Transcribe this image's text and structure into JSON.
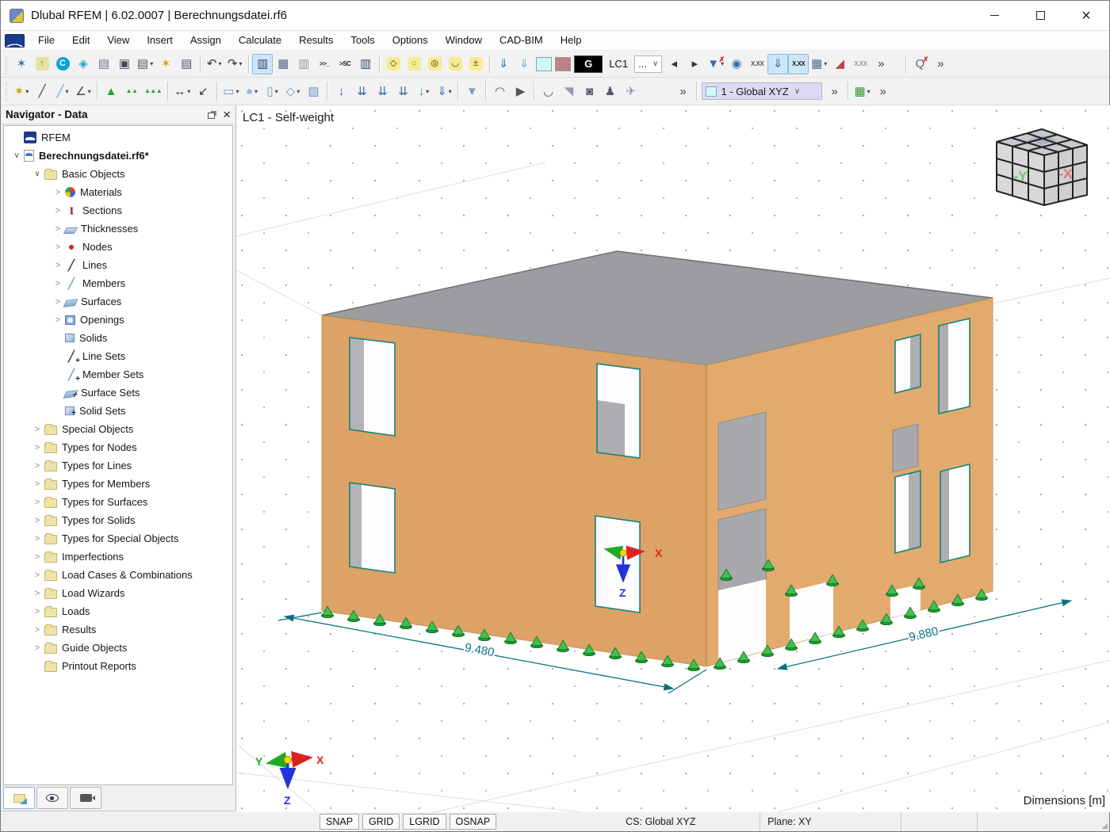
{
  "window": {
    "title": "Dlubal RFEM | 6.02.0007 | Berechnungsdatei.rf6"
  },
  "menu": {
    "items": [
      "File",
      "Edit",
      "View",
      "Insert",
      "Assign",
      "Calculate",
      "Results",
      "Tools",
      "Options",
      "Window",
      "CAD-BIM",
      "Help"
    ]
  },
  "toolbar1": [
    {
      "type": "handle"
    },
    {
      "name": "new-model-button",
      "glyph": "✶",
      "color": "#3a6ea5"
    },
    {
      "name": "open-model-button",
      "glyph": "↑",
      "color": "#2fa03c",
      "bg": "#eadfa4"
    },
    {
      "name": "dlubal-center-button",
      "glyph": "C",
      "color": "#ffffff",
      "bg": "#00a3d9",
      "round": true
    },
    {
      "name": "open-cloud-model-button",
      "glyph": "◈",
      "color": "#28a8c8"
    },
    {
      "name": "model-settings-button",
      "glyph": "▤",
      "color": "#667788"
    },
    {
      "name": "save-button",
      "glyph": "▣",
      "color": "#444a55"
    },
    {
      "name": "print-button",
      "glyph": "▤",
      "color": "#555566",
      "dd": true
    },
    {
      "name": "new-printout-report-button",
      "glyph": "✶",
      "color": "#d4a500"
    },
    {
      "name": "printout-report-button",
      "glyph": "▤",
      "color": "#555566"
    },
    {
      "type": "sep"
    },
    {
      "name": "undo-button",
      "glyph": "↶",
      "color": "#333333",
      "dd": true
    },
    {
      "name": "redo-button",
      "glyph": "↷",
      "color": "#333333",
      "dd": true
    },
    {
      "type": "sep"
    },
    {
      "name": "navigator-toggle-button",
      "glyph": "▥",
      "color": "#334466",
      "active": true
    },
    {
      "name": "tables-toggle-button",
      "glyph": "▦",
      "color": "#556688"
    },
    {
      "name": "panel-toggle-button",
      "glyph": "▥",
      "color": "#8899aa"
    },
    {
      "name": "console-toggle-button",
      "glyph": ">>_",
      "small": true,
      "color": "#222222"
    },
    {
      "name": "script-console-button",
      "glyph": ">SC",
      "small": true,
      "color": "#222222"
    },
    {
      "name": "display-properties-button",
      "glyph": "▥",
      "color": "#334466"
    },
    {
      "type": "sep"
    },
    {
      "name": "select-polygon-button",
      "glyph": "◇",
      "color": "#8a7a1a",
      "bg": "#f5ec96"
    },
    {
      "name": "select-ellipse-button",
      "glyph": "○",
      "color": "#8a7a1a",
      "bg": "#f5ec96"
    },
    {
      "name": "select-circle-button",
      "glyph": "◎",
      "color": "#8a7a1a",
      "bg": "#f5ec96"
    },
    {
      "name": "select-freeform-button",
      "glyph": "◡",
      "color": "#8a7a1a",
      "bg": "#f5ec96"
    },
    {
      "name": "select-special-button",
      "glyph": "±",
      "color": "#8a7a1a",
      "bg": "#f5ec96"
    },
    {
      "type": "sep"
    },
    {
      "name": "load-wizard-button",
      "glyph": "⇓",
      "color": "#3a6ea5"
    },
    {
      "name": "load-transfer-button",
      "glyph": "⇓",
      "color": "#7aa4d4"
    },
    {
      "name": "color-swatch-cyan",
      "type": "swatch",
      "bg": "#cdfbf6"
    },
    {
      "name": "color-swatch-rose",
      "type": "swatch",
      "bg": "#bf8080"
    },
    {
      "name": "rendering-combo",
      "type": "combo",
      "text": "G",
      "dark": true
    },
    {
      "name": "load-case-label",
      "type": "label",
      "text": "LC1"
    },
    {
      "name": "load-case-combo",
      "type": "combo",
      "text": "...",
      "caret": "∨"
    },
    {
      "name": "previous-load-case-button",
      "glyph": "◂",
      "color": "#333333"
    },
    {
      "name": "next-load-case-button",
      "glyph": "▸",
      "color": "#333333"
    },
    {
      "name": "filter-loads-button",
      "glyph": "▼",
      "color": "#3a6ea5",
      "x": true,
      "dd": true
    },
    {
      "name": "show-loads-button",
      "glyph": "◉",
      "color": "#3a6ea5"
    },
    {
      "name": "show-load-values-button",
      "glyph": "X.XX",
      "small": true,
      "color": "#555555"
    },
    {
      "name": "display-loads-toggle",
      "glyph": "⇓",
      "color": "#3a6ea5",
      "active": true
    },
    {
      "name": "display-load-values-toggle",
      "glyph": "X.XX",
      "small": true,
      "color": "#222222",
      "active": true
    },
    {
      "name": "result-tables-button",
      "glyph": "▦",
      "color": "#556688",
      "dd": true
    },
    {
      "name": "show-results-button",
      "glyph": "◢",
      "color": "#c04848"
    },
    {
      "name": "show-result-values-button",
      "glyph": "X.XX",
      "small": true,
      "color": "#999999"
    },
    {
      "name": "toolbar1-overflow-button",
      "glyph": "»",
      "color": "#444444"
    },
    {
      "type": "gap",
      "w": 14
    },
    {
      "type": "sep"
    },
    {
      "name": "zoom-reset-button",
      "glyph": "Q",
      "color": "#666666",
      "x": true
    },
    {
      "name": "toolbar1-overflow-2-button",
      "glyph": "»",
      "color": "#444444"
    }
  ],
  "toolbar2": [
    {
      "type": "handle"
    },
    {
      "name": "new-node-button",
      "glyph": "✶",
      "color": "#cfa000",
      "dd": true
    },
    {
      "name": "new-line-button",
      "glyph": "╱",
      "color": "#444444"
    },
    {
      "name": "new-member-button",
      "glyph": "╱",
      "color": "#7a9ed0",
      "dd": true
    },
    {
      "name": "new-polyline-button",
      "glyph": "∠",
      "color": "#444444",
      "dd": true
    },
    {
      "type": "sep"
    },
    {
      "name": "new-nodal-support-button",
      "glyph": "▲",
      "color": "#2fa03c"
    },
    {
      "name": "new-line-support-button",
      "glyph": "▲▲",
      "color": "#2fa03c",
      "small": true
    },
    {
      "name": "new-surface-support-button",
      "glyph": "▲▲▲",
      "color": "#2fa03c",
      "small": true
    },
    {
      "type": "sep"
    },
    {
      "name": "new-dimension-button",
      "glyph": "↔",
      "color": "#333333",
      "dd": true
    },
    {
      "name": "new-dimension-set-button",
      "glyph": "↙",
      "color": "#333333"
    },
    {
      "type": "sep"
    },
    {
      "name": "new-surface-button",
      "glyph": "▭",
      "color": "#6f94c8",
      "dd": true
    },
    {
      "name": "new-solid-button",
      "glyph": "●",
      "color": "#9ab4d8",
      "dd": true
    },
    {
      "name": "new-opening-button",
      "glyph": "▯",
      "color": "#6f94c8",
      "dd": true
    },
    {
      "name": "new-surface-points-button",
      "glyph": "◇",
      "color": "#6f94c8",
      "dd": true
    },
    {
      "name": "new-block-button",
      "glyph": "▧",
      "color": "#6f94c8"
    },
    {
      "type": "sep"
    },
    {
      "name": "new-nodal-load-button",
      "glyph": "↓",
      "color": "#3a6ea5"
    },
    {
      "name": "new-line-load-button",
      "glyph": "⇊",
      "color": "#3a6ea5"
    },
    {
      "name": "new-member-load-button",
      "glyph": "⇊",
      "color": "#3a6ea5"
    },
    {
      "name": "new-surface-load-button",
      "glyph": "⇊",
      "color": "#3a6ea5"
    },
    {
      "name": "new-free-load-button",
      "glyph": "↓",
      "color": "#2fa03c",
      "dd": true
    },
    {
      "name": "new-solid-load-button",
      "glyph": "⇓",
      "color": "#3a6ea5",
      "dd": true
    },
    {
      "type": "sep"
    },
    {
      "name": "visibility-filter-button",
      "glyph": "▼",
      "color": "#7a9ed0"
    },
    {
      "type": "sep"
    },
    {
      "name": "clipping-box-button",
      "glyph": "◠",
      "color": "#555555"
    },
    {
      "name": "animation-button",
      "glyph": "▶",
      "color": "#555555"
    },
    {
      "type": "sep"
    },
    {
      "name": "result-diagram-button",
      "glyph": "◡",
      "color": "#555566"
    },
    {
      "name": "surface-results-button",
      "glyph": "◥",
      "color": "#9999aa"
    },
    {
      "name": "solid-results-button",
      "glyph": "◙",
      "color": "#555566"
    },
    {
      "name": "walk-mode-button",
      "glyph": "♟",
      "color": "#555566"
    },
    {
      "name": "fly-mode-button",
      "glyph": "✈",
      "color": "#8899aa"
    },
    {
      "type": "gap",
      "w": 40
    },
    {
      "name": "toolbar2-overflow-button",
      "glyph": "»",
      "color": "#444444"
    },
    {
      "type": "sep"
    },
    {
      "name": "work-plane-combo",
      "type": "combo",
      "text": "1 - Global XYZ",
      "caret": "∨",
      "swatch": "#cdfbf6",
      "bg": "#dcdaf2",
      "w": 152
    },
    {
      "name": "work-plane-overflow-button",
      "glyph": "»",
      "color": "#444444"
    },
    {
      "type": "sep"
    },
    {
      "name": "work-plane-grid-button",
      "glyph": "▦",
      "color": "#3a9a3a",
      "dd": true
    },
    {
      "name": "toolbar2-overflow-2-button",
      "glyph": "»",
      "color": "#444444"
    }
  ],
  "navigator": {
    "title": "Navigator - Data",
    "tree": [
      {
        "label": "RFEM",
        "level": 0,
        "expand": "none",
        "icon": "rfem"
      },
      {
        "label": "Berechnungsdatei.rf6*",
        "level": 0,
        "expand": "open",
        "icon": "file",
        "bold": true
      },
      {
        "label": "Basic Objects",
        "level": 1,
        "expand": "open",
        "icon": "folder"
      },
      {
        "label": "Materials",
        "level": 2,
        "expand": "closed",
        "icon": "materials"
      },
      {
        "label": "Sections",
        "level": 2,
        "expand": "closed",
        "icon": "sections"
      },
      {
        "label": "Thicknesses",
        "level": 2,
        "expand": "closed",
        "icon": "thickness"
      },
      {
        "label": "Nodes",
        "level": 2,
        "expand": "closed",
        "icon": "node"
      },
      {
        "label": "Lines",
        "level": 2,
        "expand": "closed",
        "icon": "line"
      },
      {
        "label": "Members",
        "level": 2,
        "expand": "closed",
        "icon": "member"
      },
      {
        "label": "Surfaces",
        "level": 2,
        "expand": "closed",
        "icon": "surface"
      },
      {
        "label": "Openings",
        "level": 2,
        "expand": "closed",
        "icon": "opening"
      },
      {
        "label": "Solids",
        "level": 2,
        "expand": "none",
        "icon": "solid"
      },
      {
        "label": "Line Sets",
        "level": 2,
        "expand": "none",
        "icon": "lineset"
      },
      {
        "label": "Member Sets",
        "level": 2,
        "expand": "none",
        "icon": "memberset"
      },
      {
        "label": "Surface Sets",
        "level": 2,
        "expand": "none",
        "icon": "surfaceset"
      },
      {
        "label": "Solid Sets",
        "level": 2,
        "expand": "none",
        "icon": "solidset"
      },
      {
        "label": "Special Objects",
        "level": 1,
        "expand": "closed",
        "icon": "folder"
      },
      {
        "label": "Types for Nodes",
        "level": 1,
        "expand": "closed",
        "icon": "folder"
      },
      {
        "label": "Types for Lines",
        "level": 1,
        "expand": "closed",
        "icon": "folder"
      },
      {
        "label": "Types for Members",
        "level": 1,
        "expand": "closed",
        "icon": "folder"
      },
      {
        "label": "Types for Surfaces",
        "level": 1,
        "expand": "closed",
        "icon": "folder"
      },
      {
        "label": "Types for Solids",
        "level": 1,
        "expand": "closed",
        "icon": "folder"
      },
      {
        "label": "Types for Special Objects",
        "level": 1,
        "expand": "closed",
        "icon": "folder"
      },
      {
        "label": "Imperfections",
        "level": 1,
        "expand": "closed",
        "icon": "folder"
      },
      {
        "label": "Load Cases & Combinations",
        "level": 1,
        "expand": "closed",
        "icon": "folder"
      },
      {
        "label": "Load Wizards",
        "level": 1,
        "expand": "closed",
        "icon": "folder"
      },
      {
        "label": "Loads",
        "level": 1,
        "expand": "closed",
        "icon": "folder"
      },
      {
        "label": "Results",
        "level": 1,
        "expand": "closed",
        "icon": "folder"
      },
      {
        "label": "Guide Objects",
        "level": 1,
        "expand": "closed",
        "icon": "folder"
      },
      {
        "label": "Printout Reports",
        "level": 1,
        "expand": "none",
        "icon": "folder"
      }
    ]
  },
  "viewport": {
    "load_case_label": "LC1 - Self-weight",
    "dim_left": "9.480",
    "dim_right": "9.880",
    "dimensions_label": "Dimensions [m]",
    "axes": {
      "x": "X",
      "y": "Y",
      "z": "Z"
    },
    "cube": {
      "left_face": "-Y",
      "right_face": "-X"
    }
  },
  "statusbar": {
    "buttons": [
      "SNAP",
      "GRID",
      "LGRID",
      "OSNAP"
    ],
    "cs": "CS: Global XYZ",
    "plane": "Plane: XY",
    "grip": "◢"
  }
}
